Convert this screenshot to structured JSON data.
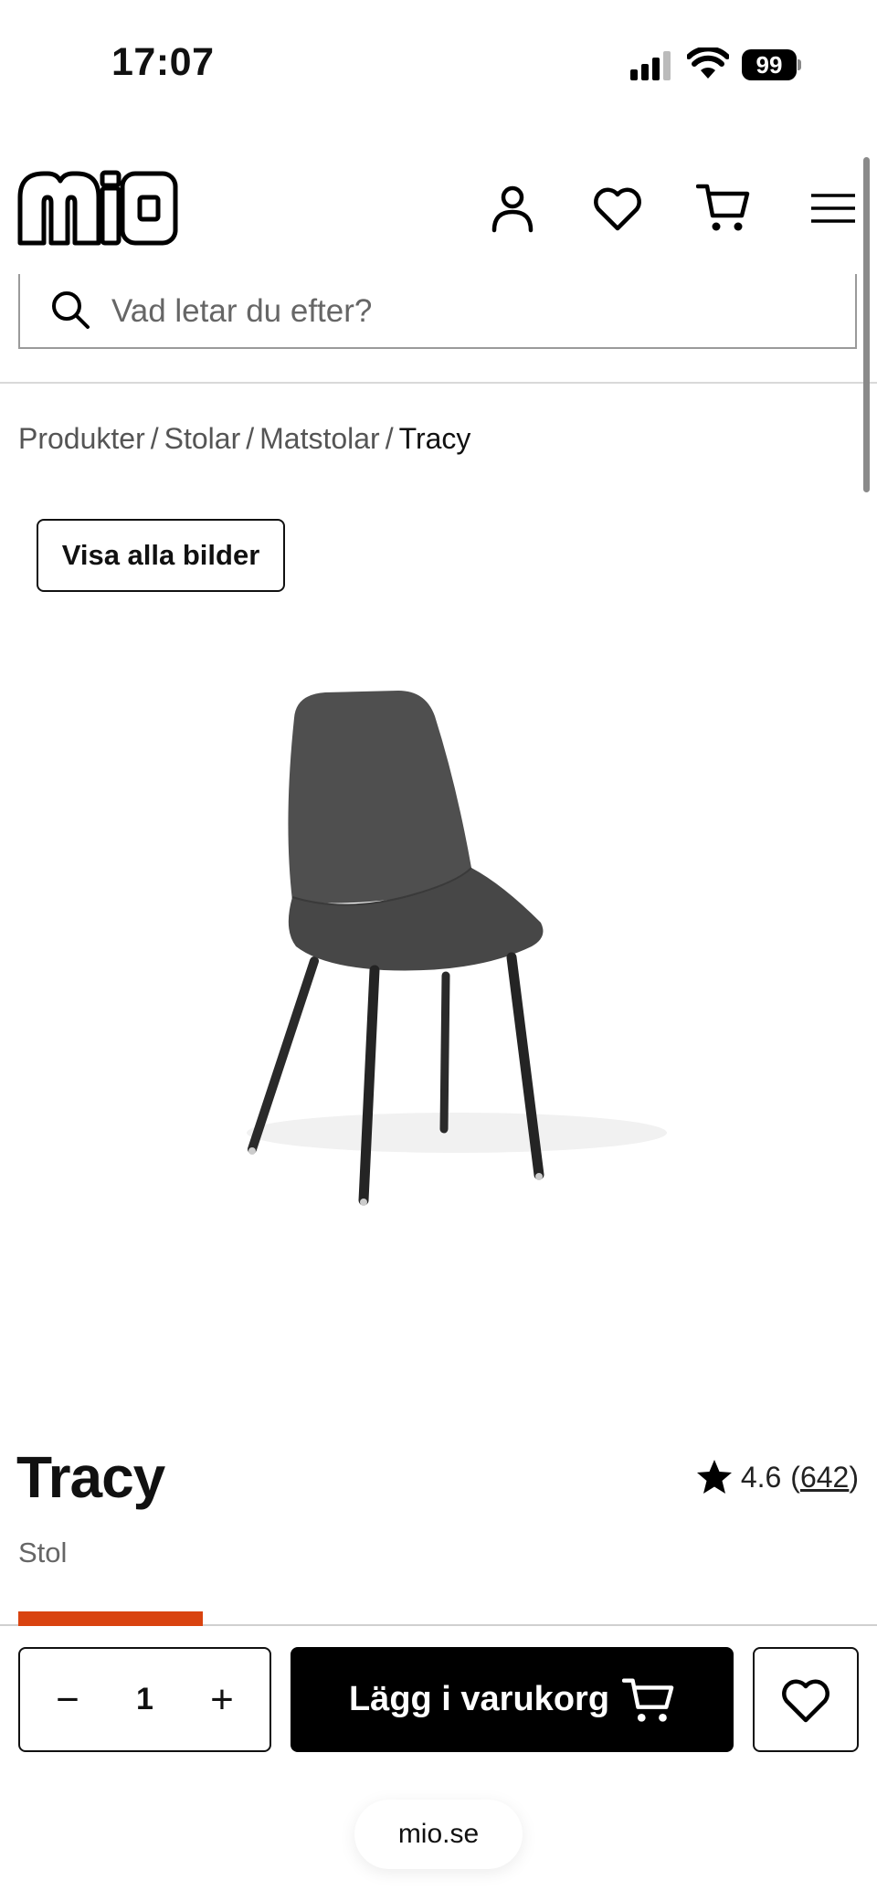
{
  "status_bar": {
    "time": "17:07",
    "battery": "99"
  },
  "header": {
    "logo_text": "mio",
    "icons": [
      "account-icon",
      "heart-icon",
      "cart-icon",
      "menu-icon"
    ]
  },
  "search": {
    "placeholder": "Vad letar du efter?"
  },
  "breadcrumb": {
    "items": [
      "Produkter",
      "Stolar",
      "Matstolar"
    ],
    "current": "Tracy",
    "separator": "/"
  },
  "gallery": {
    "show_all_label": "Visa alla bilder"
  },
  "product": {
    "name": "Tracy",
    "category": "Stol",
    "rating": "4.6",
    "review_count": "642",
    "open_paren": "(",
    "close_paren": ")"
  },
  "progress": {
    "fraction": 0.22,
    "color": "#d9430f"
  },
  "purchase": {
    "quantity": "1",
    "minus": "−",
    "plus": "+",
    "add_to_cart_label": "Lägg i varukorg"
  },
  "browser": {
    "domain": "mio.se"
  }
}
